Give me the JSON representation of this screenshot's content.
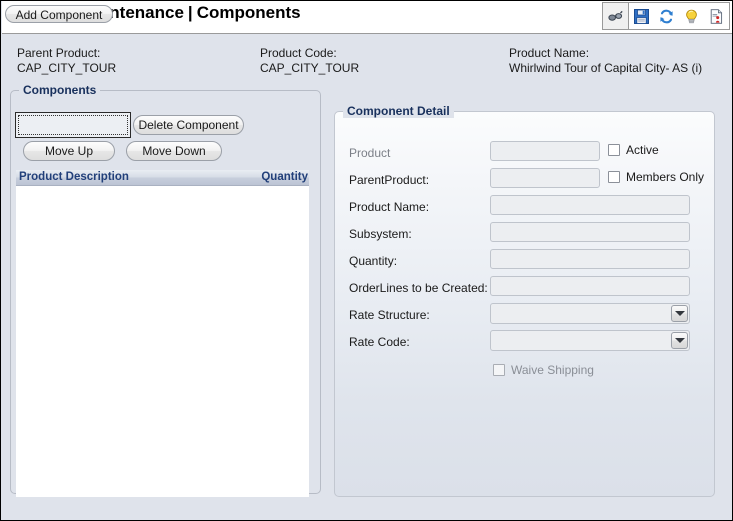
{
  "header": {
    "title_main": "Product Maintenance",
    "title_sep": "|",
    "title_sub": "Components",
    "toolbar": [
      {
        "name": "binoculars-icon",
        "label": "Search"
      },
      {
        "name": "save-icon",
        "label": "Save"
      },
      {
        "name": "refresh-icon",
        "label": "Refresh"
      },
      {
        "name": "lightbulb-icon",
        "label": "Hint"
      },
      {
        "name": "report-icon",
        "label": "Report"
      }
    ]
  },
  "info": {
    "parent_product_label": "Parent Product:",
    "parent_product_value": "CAP_CITY_TOUR",
    "product_code_label": "Product Code:",
    "product_code_value": "CAP_CITY_TOUR",
    "product_name_label": "Product Name:",
    "product_name_value": "Whirlwind Tour of Capital City- AS (i)"
  },
  "components": {
    "group_title": "Components",
    "buttons": {
      "add": "Add Component",
      "delete": "Delete Component",
      "move_up": "Move Up",
      "move_down": "Move Down"
    },
    "list": {
      "columns": [
        "Product Description",
        "Quantity"
      ],
      "rows": []
    }
  },
  "detail": {
    "group_title": "Component Detail",
    "fields": [
      {
        "label": "Product",
        "value": "",
        "type": "text",
        "disabled": true
      },
      {
        "label": "ParentProduct:",
        "value": "",
        "type": "text",
        "disabled": true
      },
      {
        "label": "Product Name:",
        "value": "",
        "type": "text",
        "disabled": true
      },
      {
        "label": "Subsystem:",
        "value": "",
        "type": "text",
        "disabled": true
      },
      {
        "label": "Quantity:",
        "value": "",
        "type": "text",
        "disabled": true
      },
      {
        "label": "OrderLines to be Created:",
        "value": "",
        "type": "text",
        "disabled": true
      },
      {
        "label": "Rate Structure:",
        "value": "",
        "type": "combo",
        "disabled": true
      },
      {
        "label": "Rate Code:",
        "value": "",
        "type": "combo",
        "disabled": true
      }
    ],
    "checkboxes": {
      "active": "Active",
      "members_only": "Members Only",
      "waive_shipping": "Waive Shipping"
    }
  },
  "colors": {
    "window_bg": "#dfe3eb",
    "header_bg": "#ffffff",
    "group_title": "#18305c",
    "list_header_text": "#22407a",
    "list_bg": "#ffffff",
    "field_bg": "#eceef1"
  }
}
